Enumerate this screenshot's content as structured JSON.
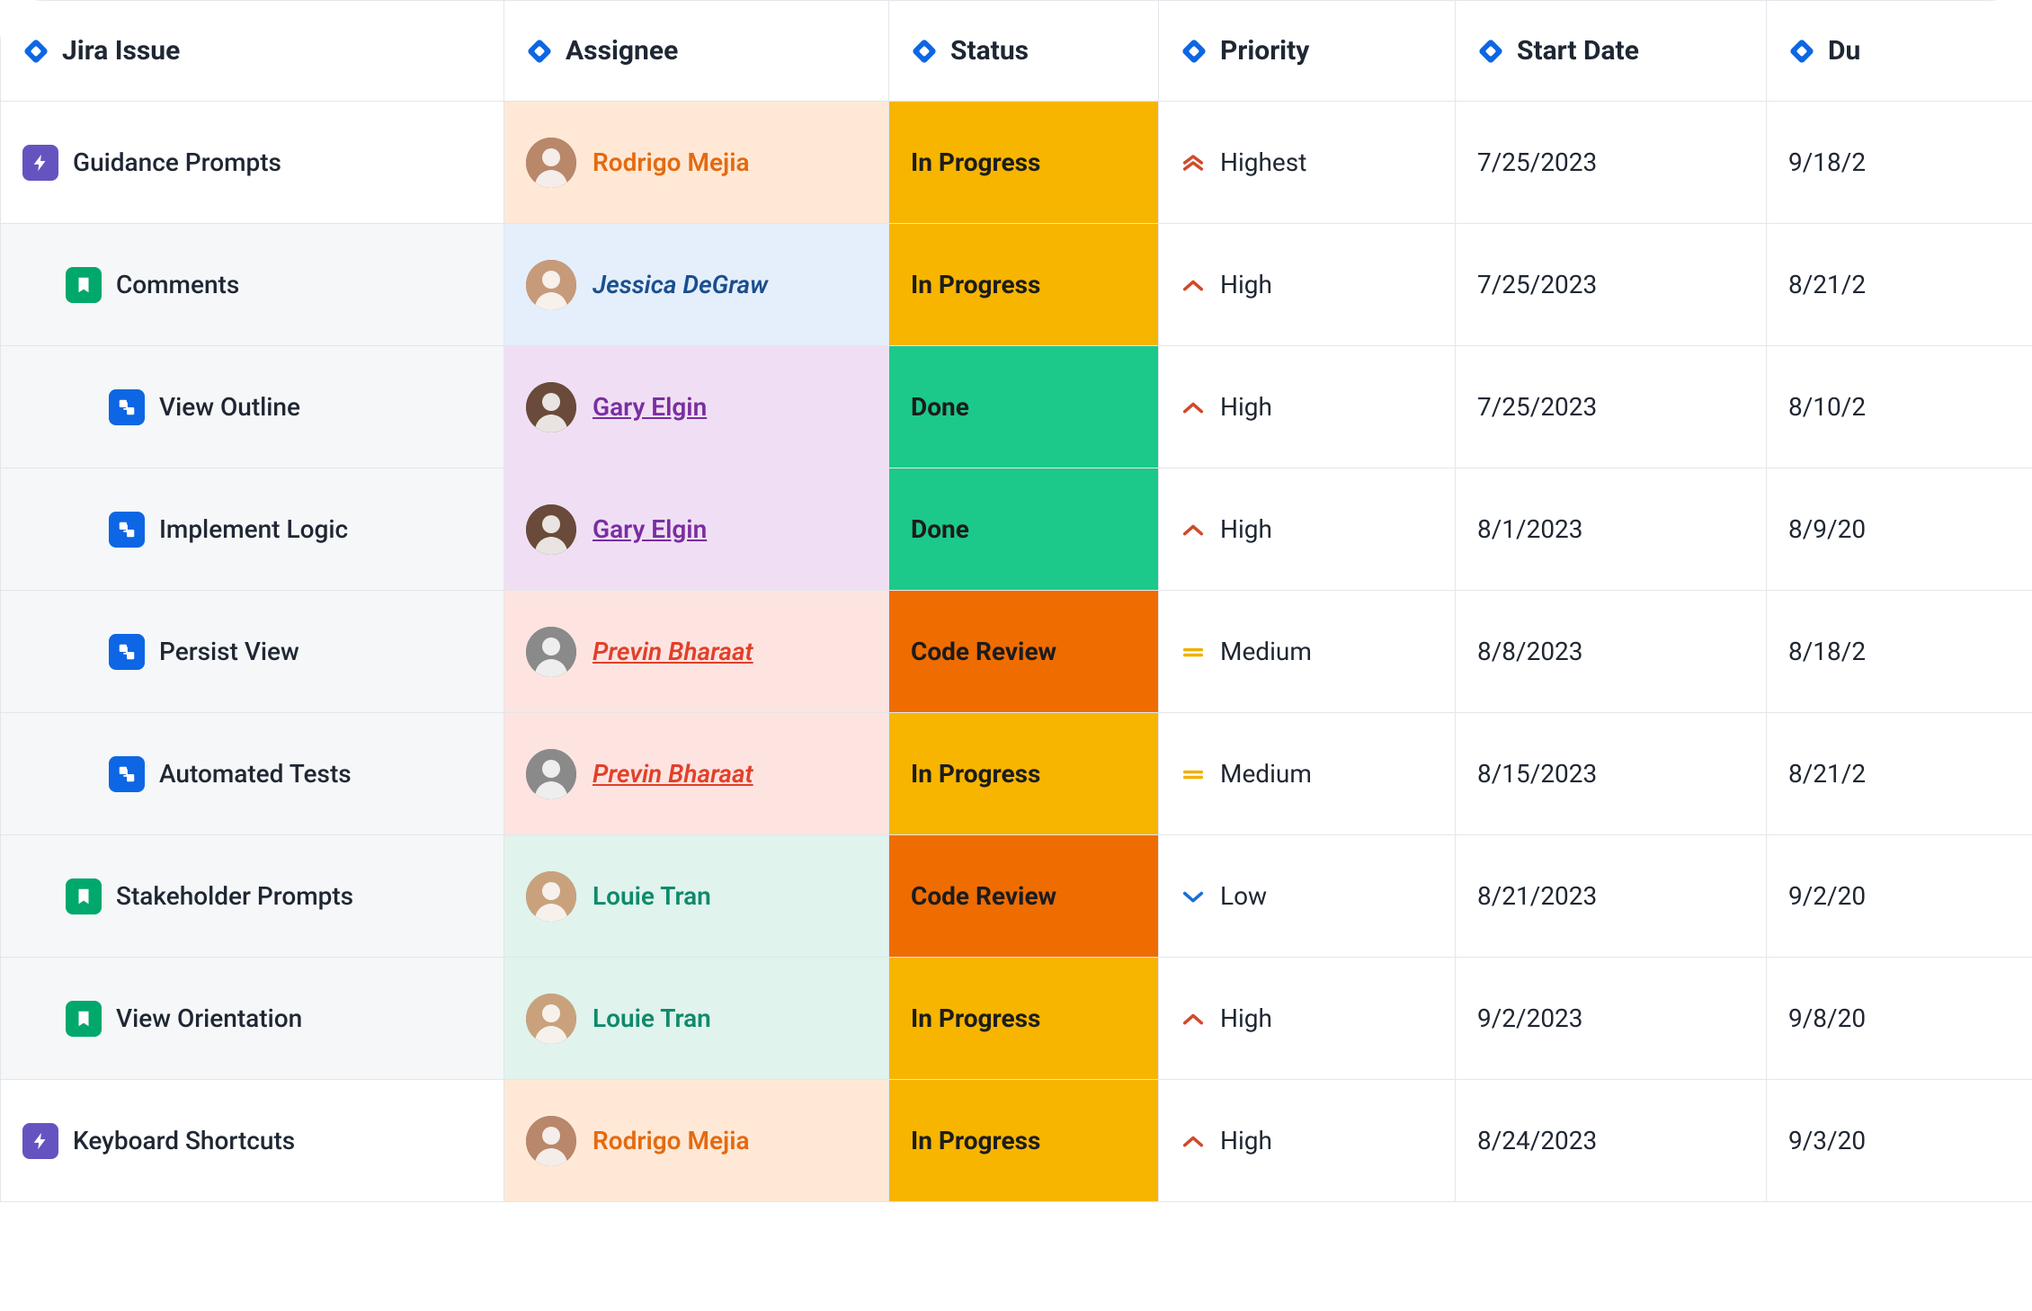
{
  "headers": {
    "issue": "Jira Issue",
    "assignee": "Assignee",
    "status": "Status",
    "priority": "Priority",
    "start": "Start Date",
    "due": "Du"
  },
  "status_labels": {
    "in_progress": "In Progress",
    "done": "Done",
    "code_review": "Code Review"
  },
  "priority_labels": {
    "highest": "Highest",
    "high": "High",
    "medium": "Medium",
    "low": "Low"
  },
  "assignees": {
    "rodrigo": "Rodrigo Mejia",
    "jessica": "Jessica DeGraw",
    "gary": "Gary Elgin",
    "previn": "Previn Bharaat",
    "louie": "Louie Tran"
  },
  "rows": [
    {
      "title": "Guidance Prompts",
      "start": "7/25/2023",
      "due": "9/18/2"
    },
    {
      "title": "Comments",
      "start": "7/25/2023",
      "due": "8/21/2"
    },
    {
      "title": "View Outline",
      "start": "7/25/2023",
      "due": "8/10/2"
    },
    {
      "title": "Implement Logic",
      "start": "8/1/2023",
      "due": "8/9/20"
    },
    {
      "title": "Persist View",
      "start": "8/8/2023",
      "due": "8/18/2"
    },
    {
      "title": "Automated Tests",
      "start": "8/15/2023",
      "due": "8/21/2"
    },
    {
      "title": "Stakeholder Prompts",
      "start": "8/21/2023",
      "due": "9/2/20"
    },
    {
      "title": "View Orientation",
      "start": "9/2/2023",
      "due": "9/8/20"
    },
    {
      "title": "Keyboard Shortcuts",
      "start": "8/24/2023",
      "due": "9/3/20"
    }
  ]
}
